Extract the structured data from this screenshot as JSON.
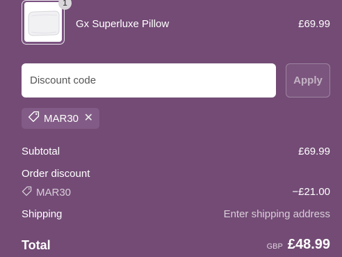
{
  "line_item": {
    "quantity": "1",
    "name": "Gx Superluxe Pillow",
    "price": "£69.99"
  },
  "discount": {
    "placeholder": "Discount code",
    "apply_label": "Apply",
    "applied_code": "MAR30"
  },
  "summary": {
    "subtotal_label": "Subtotal",
    "subtotal_value": "£69.99",
    "order_discount_label": "Order discount",
    "discount_code": "MAR30",
    "discount_value": "−£21.00",
    "shipping_label": "Shipping",
    "shipping_value": "Enter shipping address",
    "total_label": "Total",
    "currency": "GBP",
    "total_value": "£48.99"
  },
  "colors": {
    "background": "#734b75",
    "chip": "#825c86"
  }
}
